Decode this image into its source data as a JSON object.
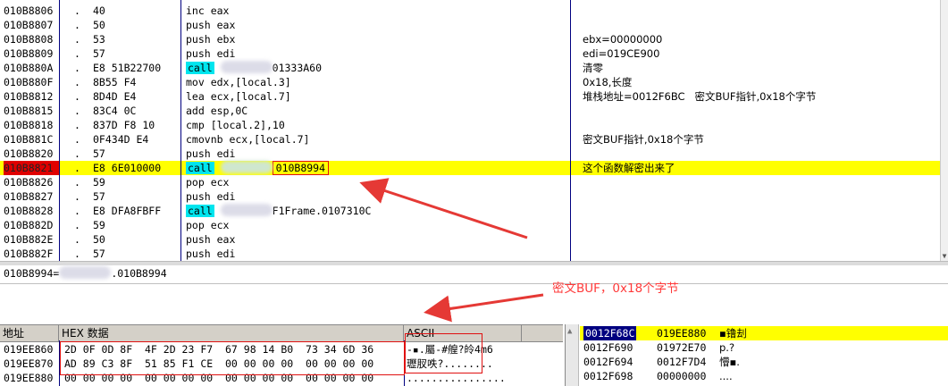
{
  "disasm": {
    "rows": [
      {
        "addr": "010B8806",
        "flag": ".",
        "hex": "40",
        "ins": "inc eax",
        "comment": ""
      },
      {
        "addr": "010B8807",
        "flag": ".",
        "hex": "50",
        "ins": "push eax",
        "comment": ""
      },
      {
        "addr": "010B8808",
        "flag": ".",
        "hex": "53",
        "ins": "push ebx",
        "comment": "ebx=00000000"
      },
      {
        "addr": "010B8809",
        "flag": ".",
        "hex": "57",
        "ins": "push edi",
        "comment": "edi=019CE900"
      },
      {
        "addr": "010B880A",
        "flag": ".",
        "hex": "E8 51B22700",
        "ins_kw": "call",
        "ins_target": "01333A60",
        "comment": "清零"
      },
      {
        "addr": "010B880F",
        "flag": ".",
        "hex": "8B55 F4",
        "ins": "mov edx,[local.3]",
        "comment": "0x18,长度"
      },
      {
        "addr": "010B8812",
        "flag": ".",
        "hex": "8D4D E4",
        "ins": "lea ecx,[local.7]",
        "comment": "堆栈地址=0012F6BC   密文BUF指针,0x18个字节"
      },
      {
        "addr": "010B8815",
        "flag": ".",
        "hex": "83C4 0C",
        "ins": "add esp,0C",
        "comment": ""
      },
      {
        "addr": "010B8818",
        "flag": ".",
        "hex": "837D F8 10",
        "ins": "cmp [local.2],10",
        "comment": ""
      },
      {
        "addr": "010B881C",
        "flag": ".",
        "hex": "0F434D E4",
        "ins": "cmovnb ecx,[local.7]",
        "comment": "密文BUF指针,0x18个字节"
      },
      {
        "addr": "010B8820",
        "flag": ".",
        "hex": "57",
        "ins": "push edi",
        "comment": ""
      },
      {
        "addr": "010B8821",
        "flag": ".",
        "hex": "E8 6E010000",
        "ins_kw": "call",
        "ins_target": "010B8994",
        "comment": "这个函数解密出来了",
        "selected": true
      },
      {
        "addr": "010B8826",
        "flag": ".",
        "hex": "59",
        "ins": "pop ecx",
        "comment": ""
      },
      {
        "addr": "010B8827",
        "flag": ".",
        "hex": "57",
        "ins": "push edi",
        "comment": ""
      },
      {
        "addr": "010B8828",
        "flag": ".",
        "hex": "E8 DFA8FBFF",
        "ins_kw": "call",
        "ins_target": "F1Frame.0107310C",
        "comment": ""
      },
      {
        "addr": "010B882D",
        "flag": ".",
        "hex": "59",
        "ins": "pop ecx",
        "comment": ""
      },
      {
        "addr": "010B882E",
        "flag": ".",
        "hex": "50",
        "ins": "push eax",
        "comment": ""
      },
      {
        "addr": "010B882F",
        "flag": ".",
        "hex": "57",
        "ins": "push edi",
        "comment": ""
      }
    ]
  },
  "info_line": {
    "left": "010B8994=",
    "right": ".010B8994"
  },
  "annotation": {
    "label": "密文BUF，0x18个字节",
    "arrow_color": "#e53935"
  },
  "dump": {
    "headers": {
      "address": "地址",
      "hex": "HEX 数据",
      "ascii": "ASCII"
    },
    "rows": [
      {
        "addr": "019EE860",
        "hex": "2D 0F 0D 8F|4F 2D 23 F7|67 98 14 B0|73 34 6D 36",
        "ascii": "-▪.屬-#艎?皊4m6"
      },
      {
        "addr": "019EE870",
        "hex": "AD 89 C3 8F|51 85 F1 CE|00 00 00 00|00 00 00 00",
        "ascii": "瓑肞呹?........"
      },
      {
        "addr": "019EE880",
        "hex": "00 00 00 00|00 00 00 00|00 00 00 00|00 00 00 00",
        "ascii": "................"
      }
    ]
  },
  "stack": {
    "rows": [
      {
        "addr": "0012F68C",
        "val": "019EE880",
        "cmt": "▪镥刦",
        "selected": true
      },
      {
        "addr": "0012F690",
        "val": "01972E70",
        "cmt": "p.?"
      },
      {
        "addr": "0012F694",
        "val": "0012F7D4",
        "cmt": "懵▪."
      },
      {
        "addr": "0012F698",
        "val": "00000000",
        "cmt": "...."
      }
    ]
  },
  "colors": {
    "highlight": "#ffff00",
    "call_keyword": "#00e5ee",
    "address_selected": "#e00000",
    "annotation": "#ff3a3a",
    "column_lines": "#000080"
  }
}
